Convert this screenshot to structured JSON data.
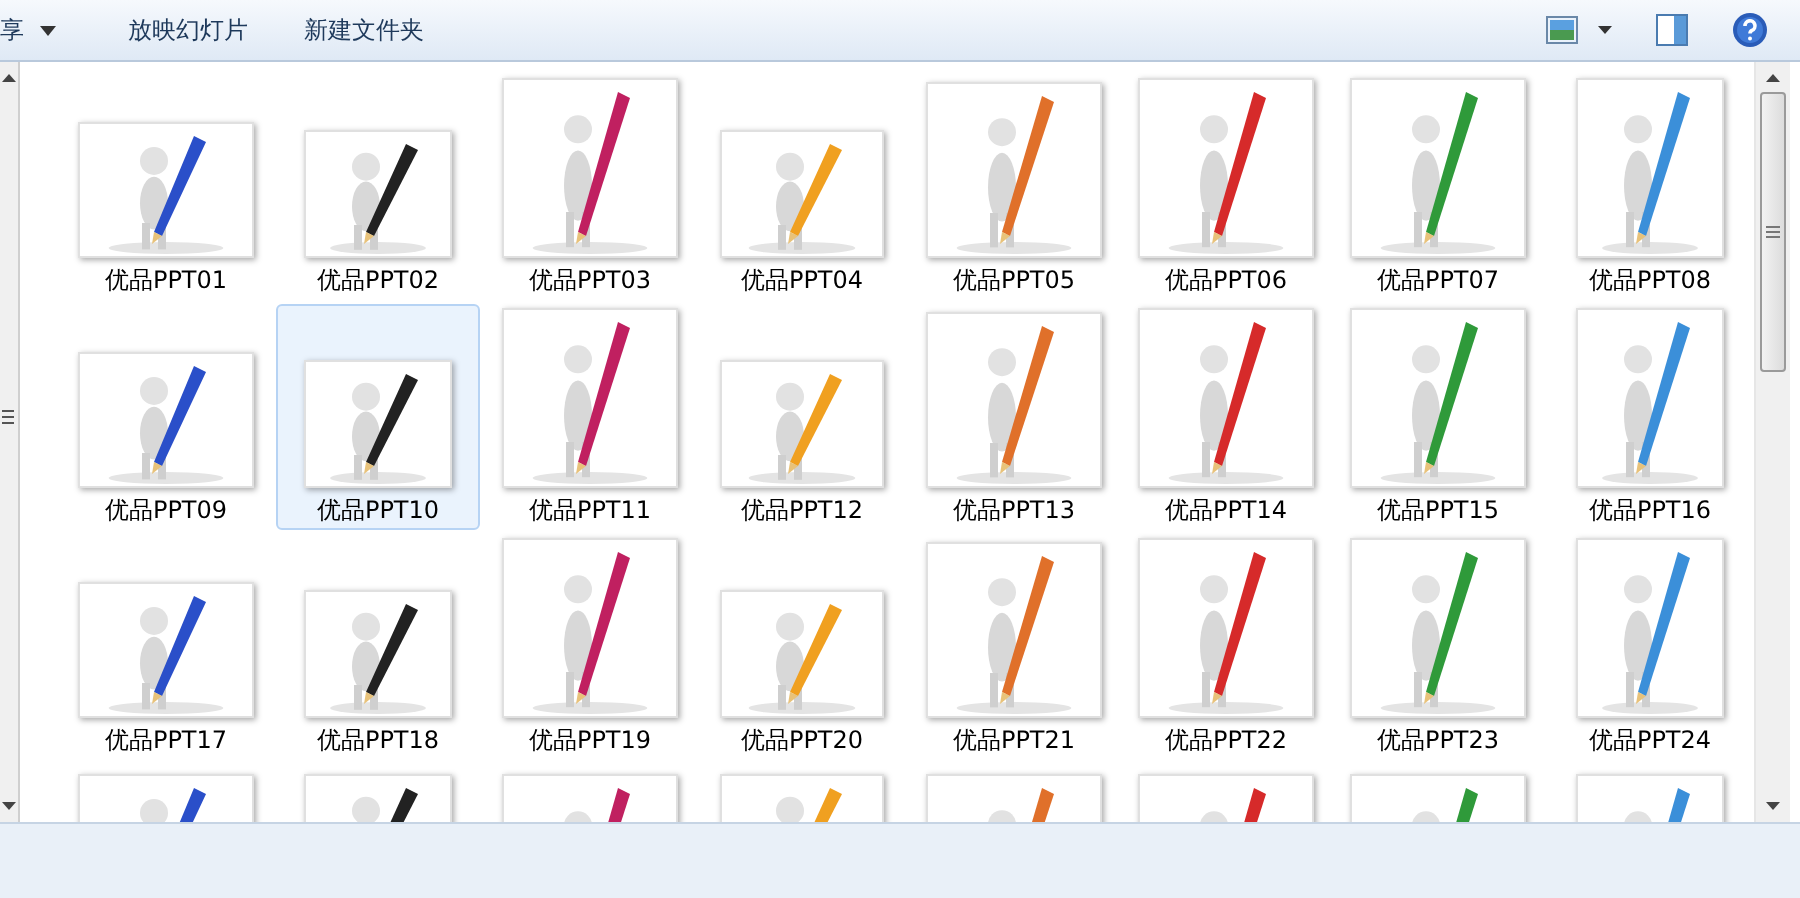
{
  "toolbar": {
    "items": [
      {
        "label": "享",
        "dropdown": true
      },
      {
        "label": "放映幻灯片",
        "dropdown": false
      },
      {
        "label": "新建文件夹",
        "dropdown": false
      }
    ]
  },
  "files": [
    {
      "label": "优品PPT01",
      "selected": false
    },
    {
      "label": "优品PPT02",
      "selected": false
    },
    {
      "label": "优品PPT03",
      "selected": false
    },
    {
      "label": "优品PPT04",
      "selected": false
    },
    {
      "label": "优品PPT05",
      "selected": false
    },
    {
      "label": "优品PPT06",
      "selected": false
    },
    {
      "label": "优品PPT07",
      "selected": false
    },
    {
      "label": "优品PPT08",
      "selected": false
    },
    {
      "label": "优品PPT09",
      "selected": false
    },
    {
      "label": "优品PPT10",
      "selected": true
    },
    {
      "label": "优品PPT11",
      "selected": false
    },
    {
      "label": "优品PPT12",
      "selected": false
    },
    {
      "label": "优品PPT13",
      "selected": false
    },
    {
      "label": "优品PPT14",
      "selected": false
    },
    {
      "label": "优品PPT15",
      "selected": false
    },
    {
      "label": "优品PPT16",
      "selected": false
    },
    {
      "label": "优品PPT17",
      "selected": false
    },
    {
      "label": "优品PPT18",
      "selected": false
    },
    {
      "label": "优品PPT19",
      "selected": false
    },
    {
      "label": "优品PPT20",
      "selected": false
    },
    {
      "label": "优品PPT21",
      "selected": false
    },
    {
      "label": "优品PPT22",
      "selected": false
    },
    {
      "label": "优品PPT23",
      "selected": false
    },
    {
      "label": "优品PPT24",
      "selected": false
    },
    {
      "kind": "picture",
      "selected": false
    },
    {
      "kind": "picture",
      "selected": false
    },
    {
      "kind": "picture",
      "selected": false
    },
    {
      "kind": "picture",
      "selected": false
    },
    {
      "kind": "picture",
      "selected": false
    },
    {
      "kind": "picture",
      "selected": false
    },
    {
      "kind": "picture",
      "selected": false
    },
    {
      "kind": "picture",
      "selected": false
    }
  ]
}
